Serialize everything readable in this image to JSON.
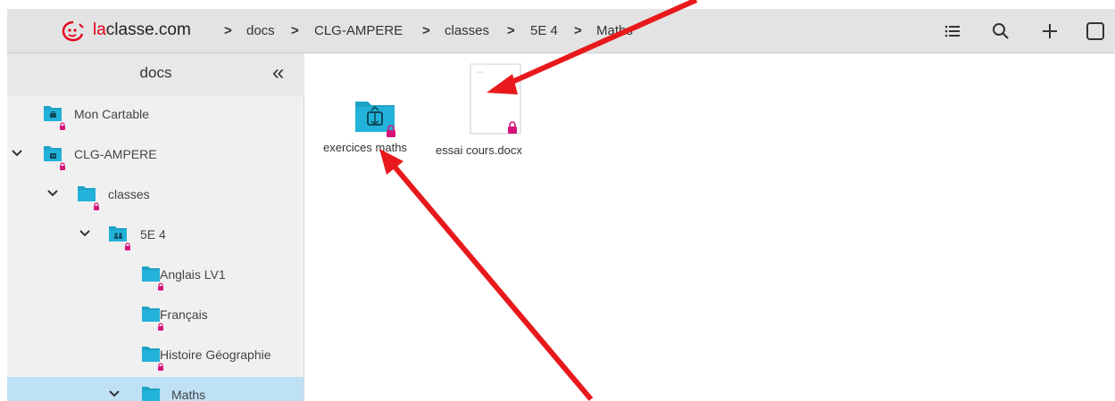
{
  "header": {
    "brand_prefix": "la",
    "brand_suffix": "classe.com",
    "breadcrumb": [
      "docs",
      "CLG-AMPERE",
      "classes",
      "5E 4",
      "Maths"
    ],
    "separator": ">",
    "icons": [
      "list-view-icon",
      "search-icon",
      "add-icon",
      "select-all-checkbox-icon"
    ]
  },
  "sidebar": {
    "title": "docs",
    "collapse_glyph": "«",
    "items": [
      {
        "label": "Mon Cartable",
        "expanded": false,
        "icon": "briefcase-folder-icon",
        "locked": true
      },
      {
        "label": "CLG-AMPERE",
        "expanded": true,
        "icon": "school-folder-icon",
        "locked": true
      },
      {
        "label": "classes",
        "expanded": true,
        "icon": "folder-icon",
        "locked": true
      },
      {
        "label": "5E 4",
        "expanded": true,
        "icon": "group-folder-icon",
        "locked": true
      },
      {
        "label": "Anglais LV1",
        "expanded": false,
        "icon": "folder-icon",
        "locked": true
      },
      {
        "label": "Français",
        "expanded": false,
        "icon": "folder-icon",
        "locked": true
      },
      {
        "label": "Histoire Géographie",
        "expanded": false,
        "icon": "folder-icon",
        "locked": true
      },
      {
        "label": "Maths",
        "expanded": true,
        "icon": "folder-icon",
        "locked": false,
        "selected": true
      }
    ]
  },
  "content": {
    "items": [
      {
        "label": "exercices maths",
        "type": "assignment-folder",
        "icon": "assignment-folder-icon",
        "locked": true
      },
      {
        "label": "essai cours.docx",
        "type": "document",
        "icon": "document-icon",
        "locked": true
      }
    ]
  },
  "colors": {
    "folder": "#1ea2c6",
    "lock": "#d6127a",
    "brand_red": "#e2001a",
    "selected_row": "#bfe1f6",
    "annotation_arrow": "#e8191c"
  }
}
